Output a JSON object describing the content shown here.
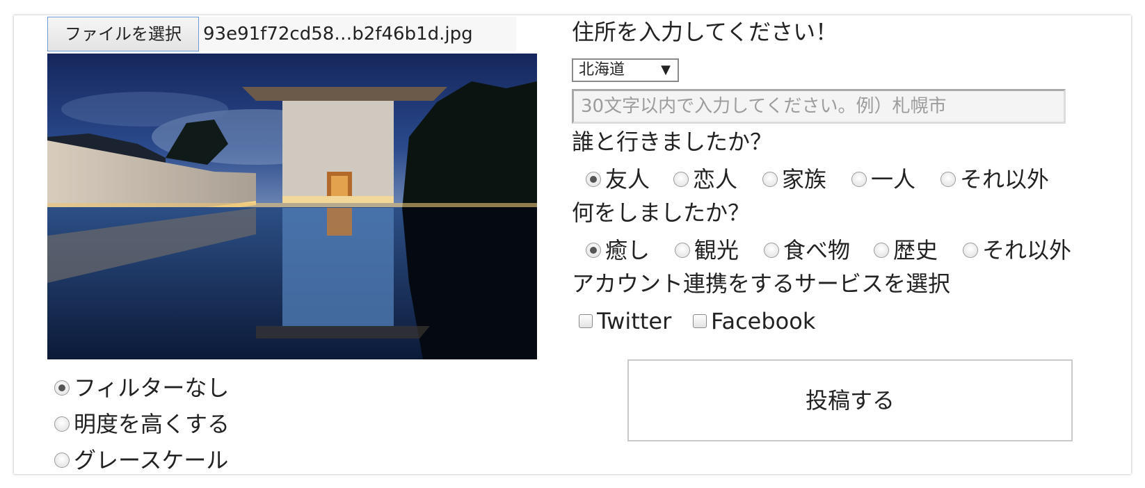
{
  "file": {
    "button_label": "ファイルを選択",
    "file_name": "93e91f72cd58…b2f46b1d.jpg"
  },
  "filters": [
    {
      "label": "フィルターなし",
      "checked": true
    },
    {
      "label": "明度を高くする",
      "checked": false
    },
    {
      "label": "グレースケール",
      "checked": false
    }
  ],
  "address": {
    "question": "住所を入力してください！",
    "prefecture": "北海道",
    "placeholder": "30文字以内で入力してください。例）札幌市"
  },
  "companion": {
    "question": "誰と行きましたか？",
    "options": [
      {
        "label": "友人",
        "checked": true
      },
      {
        "label": "恋人",
        "checked": false
      },
      {
        "label": "家族",
        "checked": false
      },
      {
        "label": "一人",
        "checked": false
      },
      {
        "label": "それ以外",
        "checked": false
      }
    ]
  },
  "activity": {
    "question": "何をしましたか？",
    "options": [
      {
        "label": "癒し",
        "checked": true
      },
      {
        "label": "観光",
        "checked": false
      },
      {
        "label": "食べ物",
        "checked": false
      },
      {
        "label": "歴史",
        "checked": false
      },
      {
        "label": "それ以外",
        "checked": false
      }
    ]
  },
  "accounts": {
    "question": "アカウント連携をするサービスを選択",
    "services": [
      {
        "label": "Twitter",
        "checked": false
      },
      {
        "label": "Facebook",
        "checked": false
      }
    ]
  },
  "submit_label": "投稿する"
}
